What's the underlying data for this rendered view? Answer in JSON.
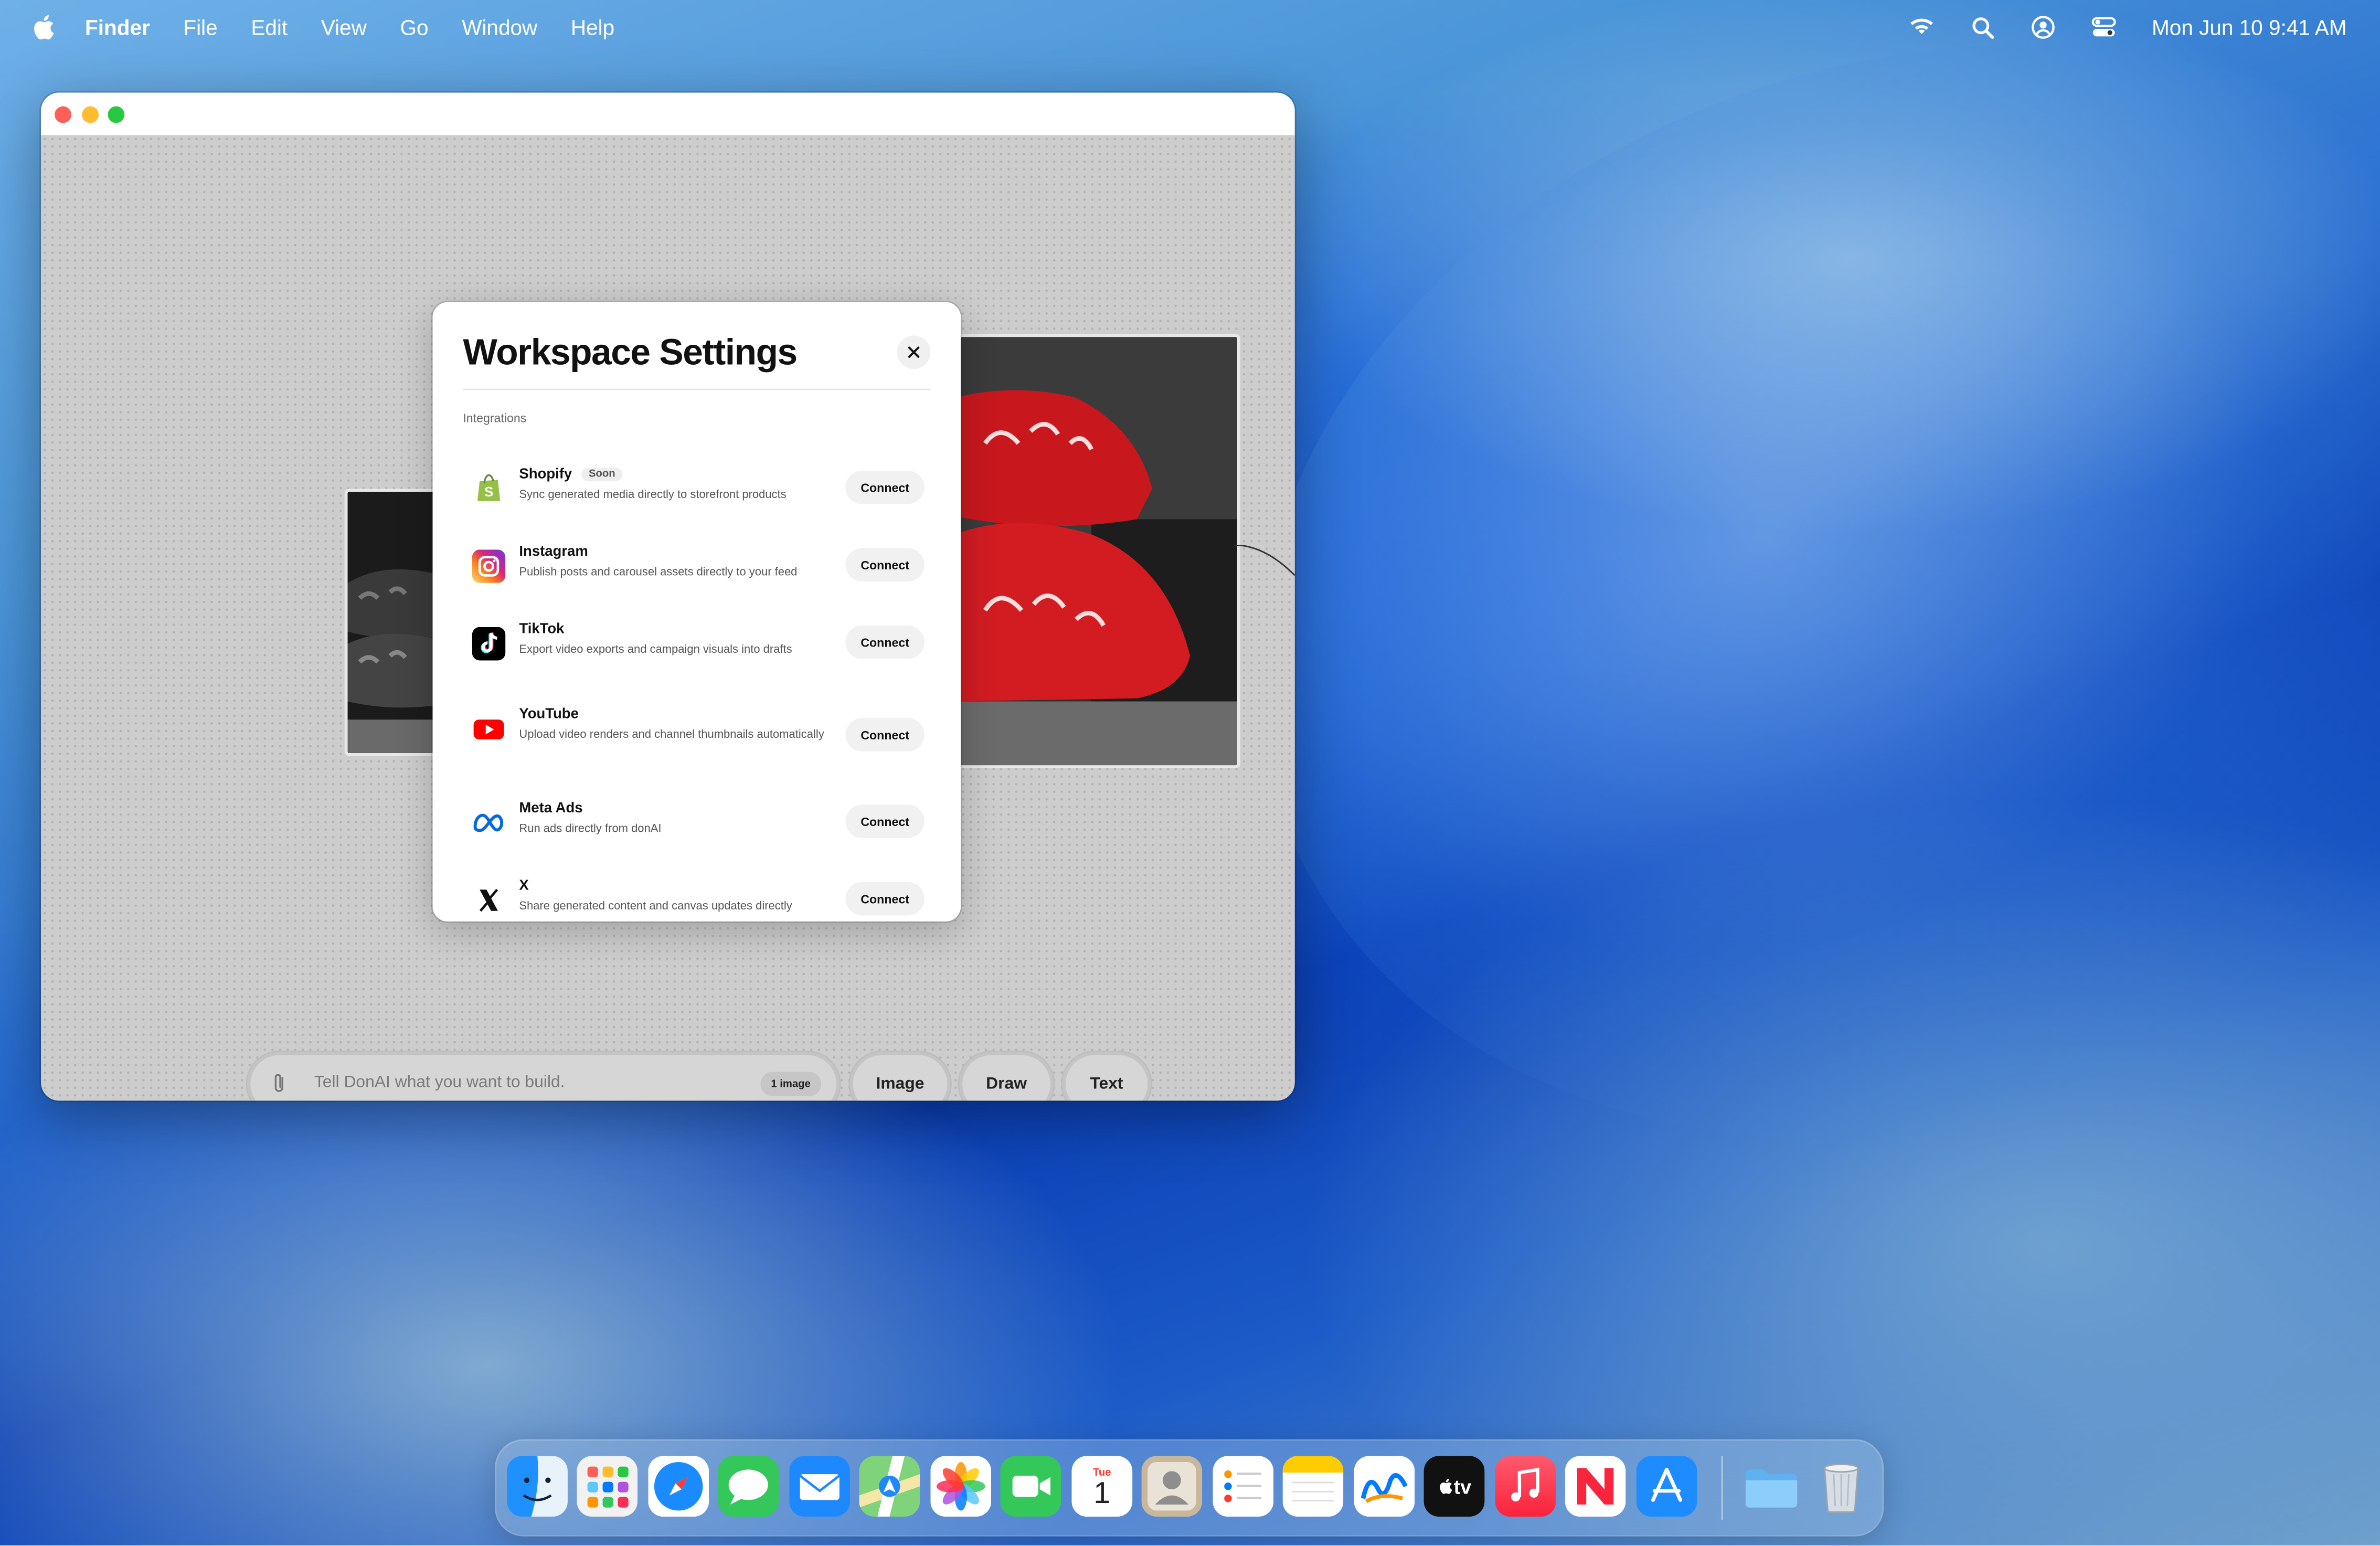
{
  "menubar": {
    "app_name": "Finder",
    "items": [
      "File",
      "Edit",
      "View",
      "Go",
      "Window",
      "Help"
    ],
    "datetime": "Mon Jun 10  9:41 AM"
  },
  "dialog": {
    "title": "Workspace Settings",
    "section_label": "Integrations",
    "integrations": [
      {
        "name": "Shopify",
        "badge": "Soon",
        "description": "Sync generated media directly to storefront products",
        "button": "Connect"
      },
      {
        "name": "Instagram",
        "description": "Publish posts and carousel assets directly to your feed",
        "button": "Connect"
      },
      {
        "name": "TikTok",
        "description": "Export video exports and campaign visuals into drafts",
        "button": "Connect"
      },
      {
        "name": "YouTube",
        "description": "Upload video renders and channel thumbnails automatically",
        "button": "Connect"
      },
      {
        "name": "Meta Ads",
        "description": "Run ads directly from donAI",
        "button": "Connect"
      },
      {
        "name": "X",
        "description": "Share generated content and canvas updates directly",
        "button": "Connect"
      }
    ]
  },
  "prompt": {
    "placeholder": "Tell DonAI what you want to build.",
    "image_count": "1 image"
  },
  "mode_buttons": [
    "Image",
    "Draw",
    "Text"
  ],
  "dock": {
    "calendar_month": "Tue",
    "calendar_day": "1",
    "tv_label": "tv",
    "apps": [
      "finder-icon",
      "launchpad-icon",
      "safari-icon",
      "messages-icon",
      "mail-icon",
      "maps-icon",
      "photos-icon",
      "facetime-icon",
      "calendar-icon",
      "contacts-icon",
      "reminders-icon",
      "notes-icon",
      "freeform-icon",
      "apple-tv-icon",
      "music-icon",
      "news-icon",
      "app-store-icon",
      "downloads-folder-icon",
      "trash-icon"
    ]
  },
  "colors": {
    "shopify": "#95bf47",
    "youtube": "#ff0000",
    "meta": "#0668e1",
    "traffic_red": "#fe5f57",
    "traffic_yellow": "#febc2e",
    "traffic_green": "#28c840"
  }
}
